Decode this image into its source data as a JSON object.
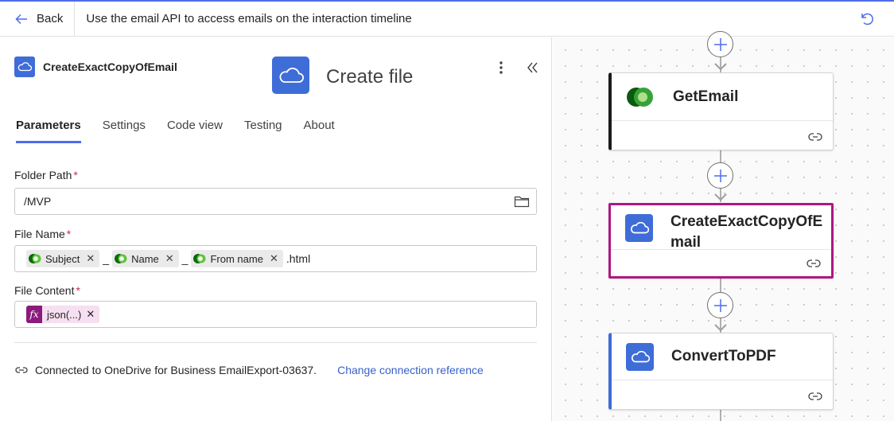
{
  "header": {
    "back_label": "Back",
    "title": "Use the email API to access emails on the interaction timeline"
  },
  "panel": {
    "action_name": "CreateExactCopyOfEmail",
    "operation_title": "Create file",
    "tabs": [
      {
        "label": "Parameters",
        "active": true
      },
      {
        "label": "Settings",
        "active": false
      },
      {
        "label": "Code view",
        "active": false
      },
      {
        "label": "Testing",
        "active": false
      },
      {
        "label": "About",
        "active": false
      }
    ],
    "folder_path": {
      "label": "Folder Path",
      "required_mark": "*",
      "value": "/MVP"
    },
    "file_name": {
      "label": "File Name",
      "required_mark": "*",
      "tokens": [
        "Subject",
        "Name",
        "From name"
      ],
      "separator": "_",
      "suffix": ".html"
    },
    "file_content": {
      "label": "File Content",
      "required_mark": "*",
      "fx_token": "json(...)",
      "fx_symbol": "fx"
    },
    "connection": {
      "text": "Connected to OneDrive for Business EmailExport-03637.",
      "link": "Change connection reference"
    }
  },
  "canvas": {
    "cards": [
      {
        "name": "GetEmail",
        "icon": "dataverse-icon",
        "accent": "#1b1b1b"
      },
      {
        "name_line1": "CreateExactCopyOfE",
        "name_line2": "mail",
        "icon": "onedrive-icon",
        "accent": "#b0177e"
      },
      {
        "name": "ConvertToPDF",
        "icon": "onedrive-icon",
        "accent": "#3f6dd8"
      }
    ]
  },
  "colors": {
    "brand_blue": "#4f6bed",
    "onedrive_blue": "#3f6dd8",
    "selected_border": "#b0177e",
    "fx_purple": "#8b1a7c",
    "required_red": "#c4314b"
  }
}
